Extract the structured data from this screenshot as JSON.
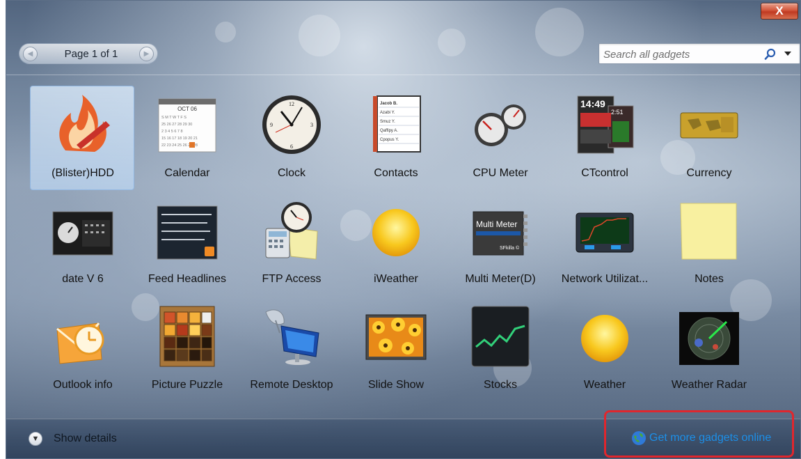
{
  "window": {
    "close_label": "X"
  },
  "toolbar": {
    "pager_label": "Page 1 of 1",
    "prev_icon": "chevron-left-icon",
    "next_icon": "chevron-right-icon",
    "search_placeholder": "Search all gadgets",
    "search_icon": "search-icon",
    "search_dropdown_icon": "dropdown-arrow-icon"
  },
  "gadgets": [
    {
      "label": "(Blister)HDD",
      "icon": "flame-hdd-icon",
      "selected": true
    },
    {
      "label": "Calendar",
      "icon": "calendar-icon"
    },
    {
      "label": "Clock",
      "icon": "clock-icon"
    },
    {
      "label": "Contacts",
      "icon": "contacts-icon"
    },
    {
      "label": "CPU Meter",
      "icon": "cpu-meter-icon"
    },
    {
      "label": "CTcontrol",
      "icon": "ctcontrol-icon"
    },
    {
      "label": "Currency",
      "icon": "currency-icon"
    },
    {
      "label": "date V 6",
      "icon": "date-icon"
    },
    {
      "label": "Feed Headlines",
      "icon": "feed-headlines-icon"
    },
    {
      "label": "FTP Access",
      "icon": "ftp-access-icon"
    },
    {
      "label": "iWeather",
      "icon": "sun-icon"
    },
    {
      "label": "Multi Meter(D)",
      "icon": "multi-meter-icon"
    },
    {
      "label": "Network Utilizat...",
      "icon": "network-icon"
    },
    {
      "label": "Notes",
      "icon": "notes-icon"
    },
    {
      "label": "Outlook info",
      "icon": "outlook-icon"
    },
    {
      "label": "Picture Puzzle",
      "icon": "puzzle-icon"
    },
    {
      "label": "Remote Desktop",
      "icon": "remote-desktop-icon"
    },
    {
      "label": "Slide Show",
      "icon": "slide-show-icon"
    },
    {
      "label": "Stocks",
      "icon": "stocks-icon"
    },
    {
      "label": "Weather",
      "icon": "sun-icon"
    },
    {
      "label": "Weather Radar",
      "icon": "radar-icon"
    }
  ],
  "calendar_icon": {
    "month": "OCT 06"
  },
  "contacts_icon": {
    "names": [
      "Jacob B.",
      "Azabi Y.",
      "Smuz Y.",
      "Qaffipy A.",
      "Cpopus Y."
    ]
  },
  "ctcontrol_icon": {
    "time_main": "14:49",
    "time_side": "2:51"
  },
  "multimeter_icon": {
    "title": "Multi Meter",
    "footer": "SFkilla ©"
  },
  "footer": {
    "show_details_label": "Show details",
    "more_online_label": "Get more gadgets online"
  },
  "colors": {
    "link": "#1c8fe8",
    "highlight": "#e0262d",
    "selected_bg": "#c8dff6"
  }
}
